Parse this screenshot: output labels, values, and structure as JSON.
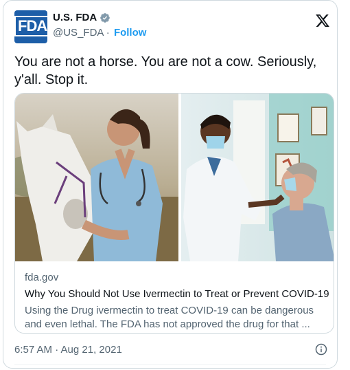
{
  "account": {
    "name": "U.S. FDA",
    "handle": "@US_FDA",
    "separator": "·",
    "follow_label": "Follow",
    "avatar_text": "FDA"
  },
  "tweet": {
    "text": "You are not a horse. You are not a cow. Seriously, y'all. Stop it."
  },
  "card": {
    "domain": "fda.gov",
    "title": "Why You Should Not Use Ivermectin to Treat or Prevent COVID-19",
    "description": "Using the Drug ivermectin to treat COVID-19 can be dangerous and even lethal. The FDA has not approved the drug for that ..."
  },
  "footer": {
    "timestamp": "6:57 AM · Aug 21, 2021"
  },
  "colors": {
    "accent": "#1d9bf0",
    "fda_blue": "#1d5ea8",
    "muted_text": "#536471"
  },
  "icons": [
    "verified-badge-icon",
    "x-logo-icon",
    "info-icon"
  ]
}
